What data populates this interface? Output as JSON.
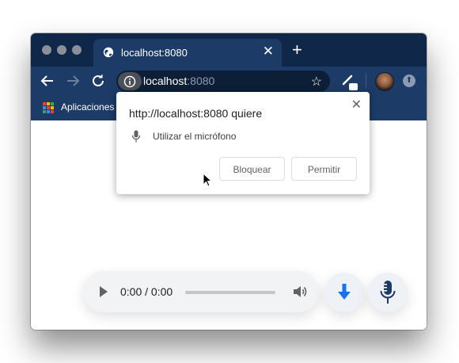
{
  "colors": {
    "chrome_frame": "#0f2748",
    "toolbar": "#1c3b66",
    "accent_blue": "#1a73e8"
  },
  "tab": {
    "title": "localhost:8080",
    "favicon": "globe-icon"
  },
  "omnibox": {
    "host": "localhost",
    "port": ":8080"
  },
  "bookmarks": {
    "apps_label": "Aplicaciones"
  },
  "permission_popup": {
    "title": "http://localhost:8080 quiere",
    "permission": "Utilizar el micrófono",
    "block_label": "Bloquear",
    "allow_label": "Permitir"
  },
  "player": {
    "time": "0:00 / 0:00",
    "progress": 0
  },
  "icons": [
    "back-icon",
    "forward-icon",
    "reload-icon",
    "info-icon",
    "star-icon",
    "extension-icon",
    "avatar",
    "update-icon",
    "apps-icon",
    "mic-icon",
    "close-icon",
    "play-icon",
    "volume-icon",
    "download-icon",
    "record-mic-icon",
    "cursor-icon"
  ]
}
